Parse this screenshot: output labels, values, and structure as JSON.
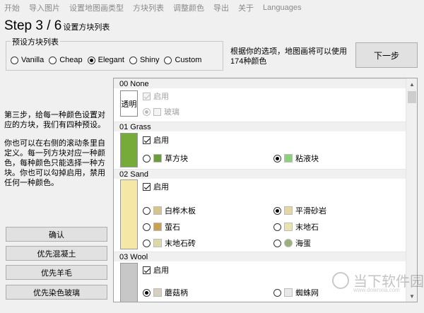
{
  "menu": [
    "开始",
    "导入图片",
    "设置地图画类型",
    "方块列表",
    "调整颜色",
    "导出",
    "关于",
    "Languages"
  ],
  "step": {
    "title_main": "Step 3 / 6",
    "title_sub": "设置方块列表"
  },
  "preset": {
    "legend": "预设方块列表",
    "options": [
      {
        "label": "Vanilla",
        "selected": false
      },
      {
        "label": "Cheap",
        "selected": false
      },
      {
        "label": "Elegant",
        "selected": true
      },
      {
        "label": "Shiny",
        "selected": false
      },
      {
        "label": "Custom",
        "selected": false
      }
    ]
  },
  "info": {
    "text": "根据你的选项，地图画将可以使用174种颜色"
  },
  "next_button": {
    "label": "下一步"
  },
  "description": {
    "para1": "第三步，给每一种颜色设置对应的方块，我们有四种预设。",
    "para2": "你也可以在右侧的滚动条里自定义。每一列方块对应一种颜色，每种颜色只能选择一种方块。你也可以勾掉启用，禁用任何一种颜色。"
  },
  "left_buttons": [
    "确认",
    "优先混凝土",
    "优先羊毛",
    "优先染色玻璃"
  ],
  "blocks": {
    "none": {
      "header": "00 None",
      "swatch_label": "透明",
      "enable_label": "启用",
      "glass_label": "玻璃"
    },
    "grass": {
      "header": "01 Grass",
      "color": "#76ab3a",
      "enable_label": "启用",
      "options": [
        {
          "label": "草方块",
          "selected": false,
          "tex": "#6d9c3a"
        },
        {
          "label": "粘液块",
          "selected": true,
          "tex": "#8fd17a"
        }
      ]
    },
    "sand": {
      "header": "02 Sand",
      "color": "#f5e8a6",
      "enable_label": "启用",
      "options": [
        {
          "label": "白桦木板",
          "selected": false,
          "tex": "#d6c58a"
        },
        {
          "label": "平滑砂岩",
          "selected": true,
          "tex": "#e3d7a4"
        },
        {
          "label": "萤石",
          "selected": false,
          "tex": "#c9a155"
        },
        {
          "label": "末地石",
          "selected": false,
          "tex": "#e7e4b0"
        },
        {
          "label": "末地石砖",
          "selected": false,
          "tex": "#dcdaa8"
        },
        {
          "label": "海蛋",
          "selected": false,
          "tex": "#9bb07a"
        }
      ]
    },
    "wool": {
      "header": "03 Wool",
      "color": "#c7c7c7",
      "enable_label": "启用",
      "options": [
        {
          "label": "蘑菇柄",
          "selected": true,
          "tex": "#d7d0c0"
        },
        {
          "label": "蜘蛛网",
          "selected": false,
          "tex": "#e8e8e8"
        }
      ]
    }
  },
  "watermark": {
    "text": "当下软件园",
    "url": "www.downxia.com"
  }
}
